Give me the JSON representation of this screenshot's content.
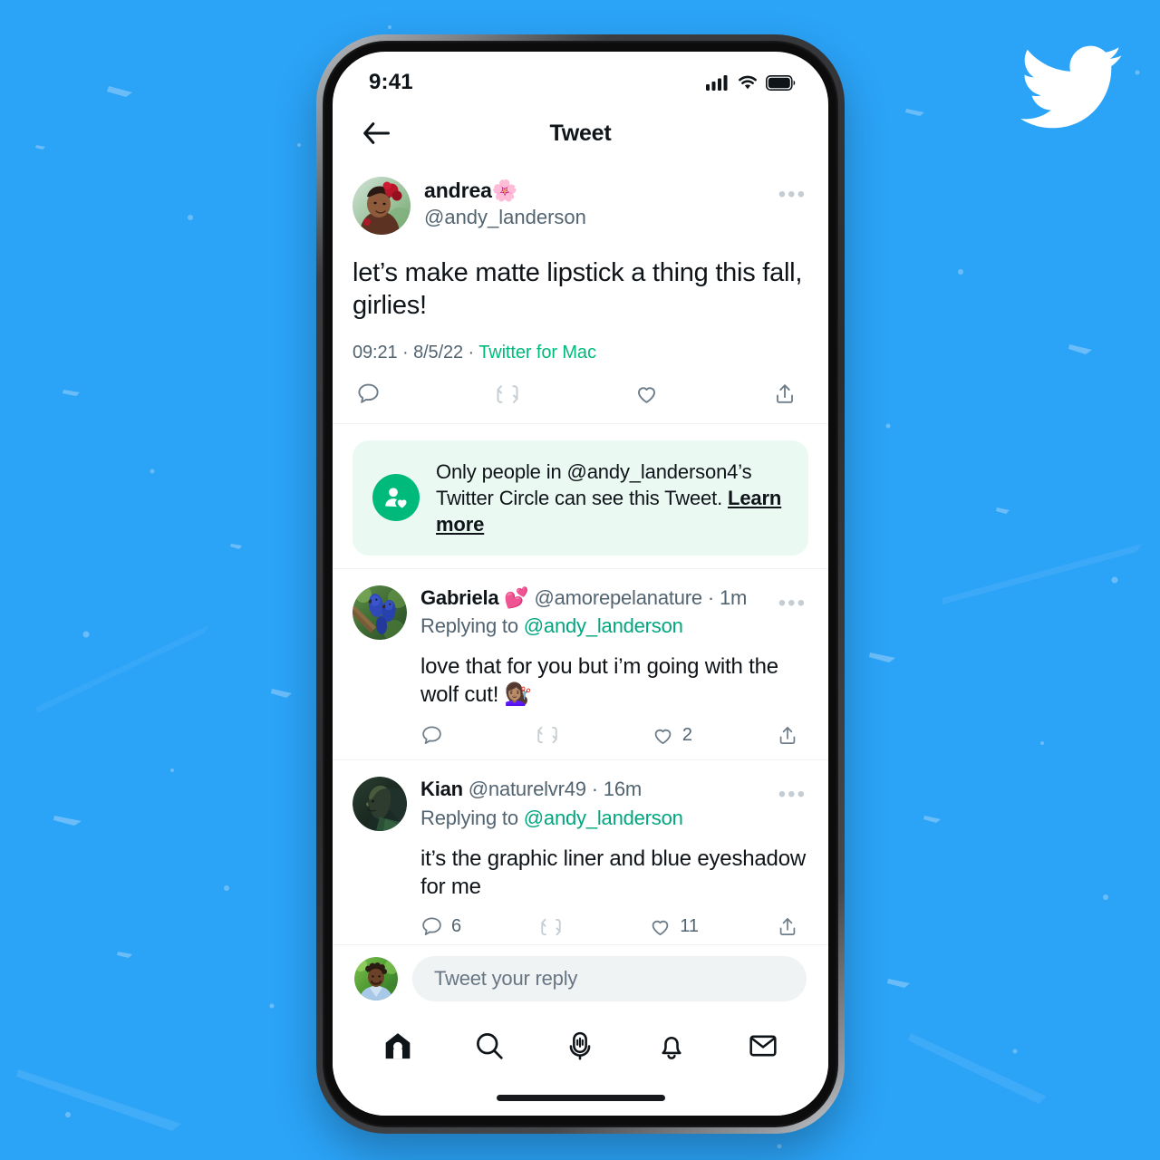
{
  "background": {
    "color": "#2BA3F7",
    "texture": "speckled-paint-flecks"
  },
  "brand": {
    "logo_icon": "twitter-bird-icon",
    "logo_color": "#FFFFFF"
  },
  "phone": {
    "status_bar": {
      "time": "9:41",
      "icons": [
        "cellular-signal-icon",
        "wifi-icon",
        "battery-icon"
      ]
    },
    "home_indicator": true
  },
  "header": {
    "back_icon": "back-arrow-icon",
    "title": "Tweet"
  },
  "main_tweet": {
    "avatar_alt": "woman-with-red-flower-avatar",
    "display_name": "andrea",
    "display_name_emoji": "🌸",
    "handle": "@andy_landerson",
    "more_icon": "more-options-icon",
    "text": "let’s make matte lipstick a thing this fall, girlies!",
    "time": "09:21",
    "date": "8/5/22",
    "separator": "·",
    "source": "Twitter for Mac",
    "source_color": "#00BA7C",
    "actions": [
      {
        "icon": "reply-icon",
        "count": ""
      },
      {
        "icon": "retweet-icon",
        "count": ""
      },
      {
        "icon": "like-icon",
        "count": ""
      },
      {
        "icon": "share-icon",
        "count": ""
      }
    ]
  },
  "circle_banner": {
    "icon": "twitter-circle-person-heart-icon",
    "icon_bg": "#00BA7C",
    "background": "#EBF9F3",
    "text_before": "Only people in @andy_landerson4’s Twitter Circle can see this Tweet. ",
    "learn_more_label": "Learn more"
  },
  "replies": [
    {
      "avatar_alt": "blue-macaws-avatar",
      "display_name": "Gabriela",
      "display_name_emoji": "💕",
      "handle": "@amorepelanature",
      "separator": "·",
      "timestamp": "1m",
      "more_icon": "more-options-icon",
      "replying_to_label": "Replying to ",
      "replying_to_handle": "@andy_landerson",
      "text": "love that for you but i’m going with the wolf cut! 💇🏽‍♀️",
      "actions": [
        {
          "icon": "reply-icon",
          "count": ""
        },
        {
          "icon": "retweet-icon",
          "count": ""
        },
        {
          "icon": "like-icon",
          "count": "2"
        },
        {
          "icon": "share-icon",
          "count": ""
        }
      ]
    },
    {
      "avatar_alt": "man-profile-silhouette-avatar",
      "display_name": "Kian",
      "display_name_emoji": "",
      "handle": "@naturelvr49",
      "separator": "·",
      "timestamp": "16m",
      "more_icon": "more-options-icon",
      "replying_to_label": "Replying to ",
      "replying_to_handle": "@andy_landerson",
      "text": "it’s the graphic liner and blue eyeshadow for me",
      "actions": [
        {
          "icon": "reply-icon",
          "count": "6"
        },
        {
          "icon": "retweet-icon",
          "count": ""
        },
        {
          "icon": "like-icon",
          "count": "11"
        },
        {
          "icon": "share-icon",
          "count": ""
        }
      ]
    }
  ],
  "composer": {
    "avatar_alt": "man-in-blue-shirt-avatar",
    "placeholder": "Tweet your reply"
  },
  "bottom_nav": {
    "items": [
      {
        "icon": "home-icon",
        "active": true
      },
      {
        "icon": "search-icon",
        "active": false
      },
      {
        "icon": "spaces-microphone-icon",
        "active": false
      },
      {
        "icon": "notifications-bell-icon",
        "active": false
      },
      {
        "icon": "messages-envelope-icon",
        "active": false
      }
    ]
  }
}
